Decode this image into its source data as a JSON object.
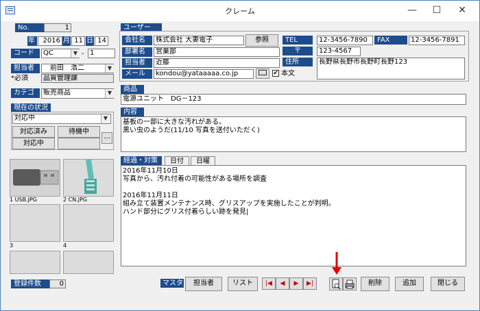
{
  "window": {
    "title": "クレーム",
    "minimize": "—",
    "maximize": "☐",
    "close": "✕"
  },
  "left": {
    "no_label": "No.",
    "no_value": "1",
    "year_label": "年",
    "year_value": "2016",
    "month_label": "月",
    "month_value": "11",
    "day_label": "日",
    "day_value": "14",
    "code_label": "コード",
    "code_value": "QC",
    "code_dash": "-",
    "code_num": "1",
    "tanto_label": "担当者",
    "tanto_value": "前田　浩二",
    "required_label": "*必須",
    "dept_value": "品質管理課",
    "category_label": "カテゴリ",
    "category_value": "販売商品",
    "status_label": "現在の状況",
    "status_value": "対応中",
    "status_btn_done": "対応済み",
    "status_btn_wait": "待機中",
    "status_btn_doing": "対応中",
    "status_btn_more": "...",
    "count_label": "登録件数",
    "count_value": "0"
  },
  "images": [
    {
      "caption": "1 USB.JPG"
    },
    {
      "caption": "2 CN.JPG"
    },
    {
      "caption": "3"
    },
    {
      "caption": "4"
    },
    {
      "caption": ""
    },
    {
      "caption": ""
    }
  ],
  "user": {
    "section_label": "ユーザー",
    "company_label": "会社名",
    "company_value": "株式会社 大妻電子",
    "ref_button": "参照",
    "dept_label": "部署名",
    "dept_value": "営業部",
    "person_label": "担当者",
    "person_value": "近藤",
    "mail_label": "メール",
    "mail_value": "kondou@yataaaaa.co.jp",
    "honbun_label": "本文",
    "honbun_checked": true,
    "tel_label": "TEL",
    "tel_value": "12-3456-7890",
    "fax_label": "FAX",
    "fax_value": "12-3456-7891",
    "zip_label": "〒",
    "zip_value": "123-4567",
    "addr_label": "住所",
    "addr_value": "長野県長野市長野町長野123"
  },
  "product": {
    "label": "商品",
    "value": "電源ユニット　DG－123"
  },
  "content": {
    "label": "内容",
    "lines": [
      "基板の一部に大きな汚れがある。",
      "黒い虫のようだ(11/10 写真を送付いただく)"
    ]
  },
  "history": {
    "label": "経過・対策",
    "date_tab": "日付",
    "weekday_tab": "日曜",
    "lines": [
      "2016年11月10日",
      "写真から、汚れ付着の可能性がある場所を調査",
      "",
      "2016年11月11日",
      "組み立て装置メンテナンス時、グリスアップを実施したことが判明。",
      "ハンド部分にグリス付着らしい跡を発見|"
    ]
  },
  "bottom": {
    "master_label": "マスター",
    "tanto_button": "担当者",
    "list_button": "リスト",
    "nav_first": "|◀",
    "nav_prev": "◀",
    "nav_next": "▶",
    "nav_last": "▶|",
    "delete_button": "削除",
    "add_button": "追加",
    "close_button": "閉じる"
  },
  "colors": {
    "section_bg": "#1e4c8c",
    "annotation_arrow": "#e00000",
    "nav_glyph": "#c00000"
  }
}
